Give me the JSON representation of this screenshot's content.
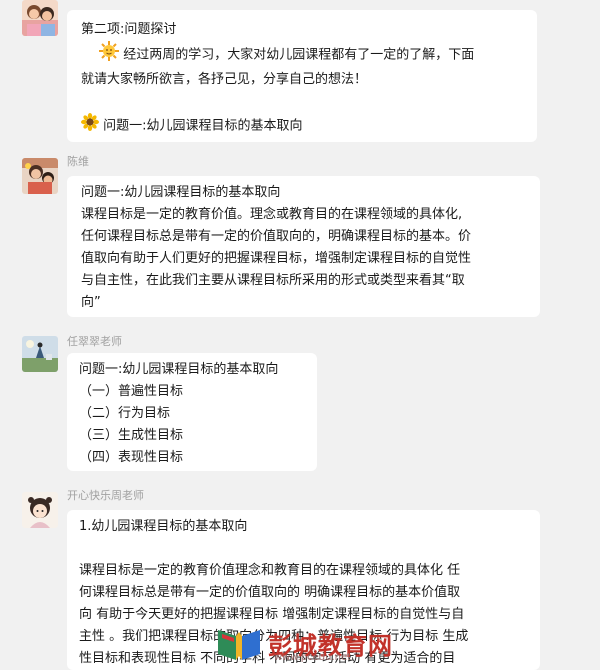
{
  "messages": [
    {
      "sender": "",
      "lines": [
        "第二项:问题探讨",
        "经过两周的学习，大家对幼儿园课程都有了一定的了解，下面",
        "就请大家畅所欲言，各抒己见，分享自己的想法！",
        "",
        "问题一:幼儿园课程目标的基本取向"
      ]
    },
    {
      "sender": "陈维",
      "lines": [
        "问题一:幼儿园课程目标的基本取向",
        "课程目标是一定的教育价值。理念或教育目的在课程领域的具体化,",
        "任何课程目标总是带有一定的价值取向的，明确课程目标的基本。价",
        "值取向有助于人们更好的把握课程目标，增强制定课程目标的自觉性",
        "与自主性，在此我们主要从课程目标所采用的形式或类型来看其“取",
        "向”"
      ]
    },
    {
      "sender": "任翠翠老师",
      "lines": [
        "问题一:幼儿园课程目标的基本取向",
        "（一）普遍性目标",
        "（二）行为目标",
        "（三）生成性目标",
        "（四）表现性目标"
      ]
    },
    {
      "sender": "开心快乐周老师",
      "lines": [
        "1.幼儿园课程目标的基本取向",
        "",
        "课程目标是一定的教育价值理念和教育目的在课程领域的具体化 任",
        "何课程目标总是带有一定的价值取向的 明确课程目标的基本价值取",
        "向 有助于今天更好的把握课程目标 增强制定课程目标的自觉性与自",
        "主性 。我们把课程目标的取向分为四种：普遍性目标 行为目标 生成",
        "性目标和表现性目标 不同的学科 不同的学习活动 有更为适合的目"
      ]
    }
  ],
  "watermark": {
    "text": "彭城教育网",
    "subtext": "www.pcedu.net"
  },
  "icons": {
    "sun": "sun-emoji-icon",
    "sunflower": "sunflower-emoji-icon"
  }
}
